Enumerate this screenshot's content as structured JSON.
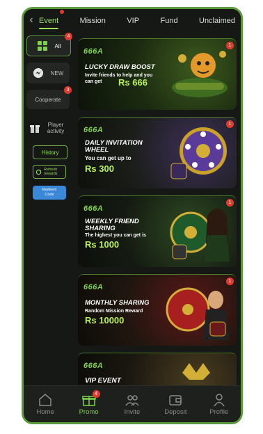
{
  "topbar": {
    "tabs": [
      {
        "label": "Event",
        "active": true
      },
      {
        "label": "Mission"
      },
      {
        "label": "VIP"
      },
      {
        "label": "Fund"
      },
      {
        "label": "Unclaimed"
      }
    ]
  },
  "sidebar": {
    "all": {
      "label": "All",
      "badge": "4"
    },
    "new": {
      "label": "NEW"
    },
    "cooperate": {
      "label": "Cooperate",
      "badge": "3"
    },
    "player_activity": {
      "label": "Player activity"
    },
    "history": "History",
    "refresh": "Refresh rewards",
    "redeem": "Redeem Code"
  },
  "banners": [
    {
      "logo": "666A",
      "title": "LUCKY DRAW BOOST",
      "subtitle": "Invite friends to help and you can get",
      "amount": "Rs 666",
      "badge": "1"
    },
    {
      "logo": "666A",
      "title": "DAILY INVITATION WHEEL",
      "subtitle": "You can get up to",
      "amount": "Rs 300",
      "badge": "1"
    },
    {
      "logo": "666A",
      "title": "WEEKLY FRIEND SHARING",
      "subtitle": "The highest you can get is",
      "amount": "Rs 1000",
      "badge": "1"
    },
    {
      "logo": "666A",
      "title": "MONTHLY SHARING",
      "subtitle": "Random Mission Reward",
      "amount": "Rs 10000",
      "badge": "1"
    },
    {
      "logo": "666A",
      "title": "VIP EVENT INTRODUCTION",
      "subtitle": "",
      "amount": ""
    }
  ],
  "bottom_nav": [
    {
      "label": "Home",
      "icon": "home-icon"
    },
    {
      "label": "Promo",
      "icon": "gift-icon",
      "active": true,
      "badge": "4"
    },
    {
      "label": "Invite",
      "icon": "users-icon"
    },
    {
      "label": "Deposit",
      "icon": "wallet-icon"
    },
    {
      "label": "Profile",
      "icon": "person-icon"
    }
  ],
  "colors": {
    "accent": "#9be05a",
    "badge": "#e23b2e",
    "border": "#5a9a3a"
  }
}
